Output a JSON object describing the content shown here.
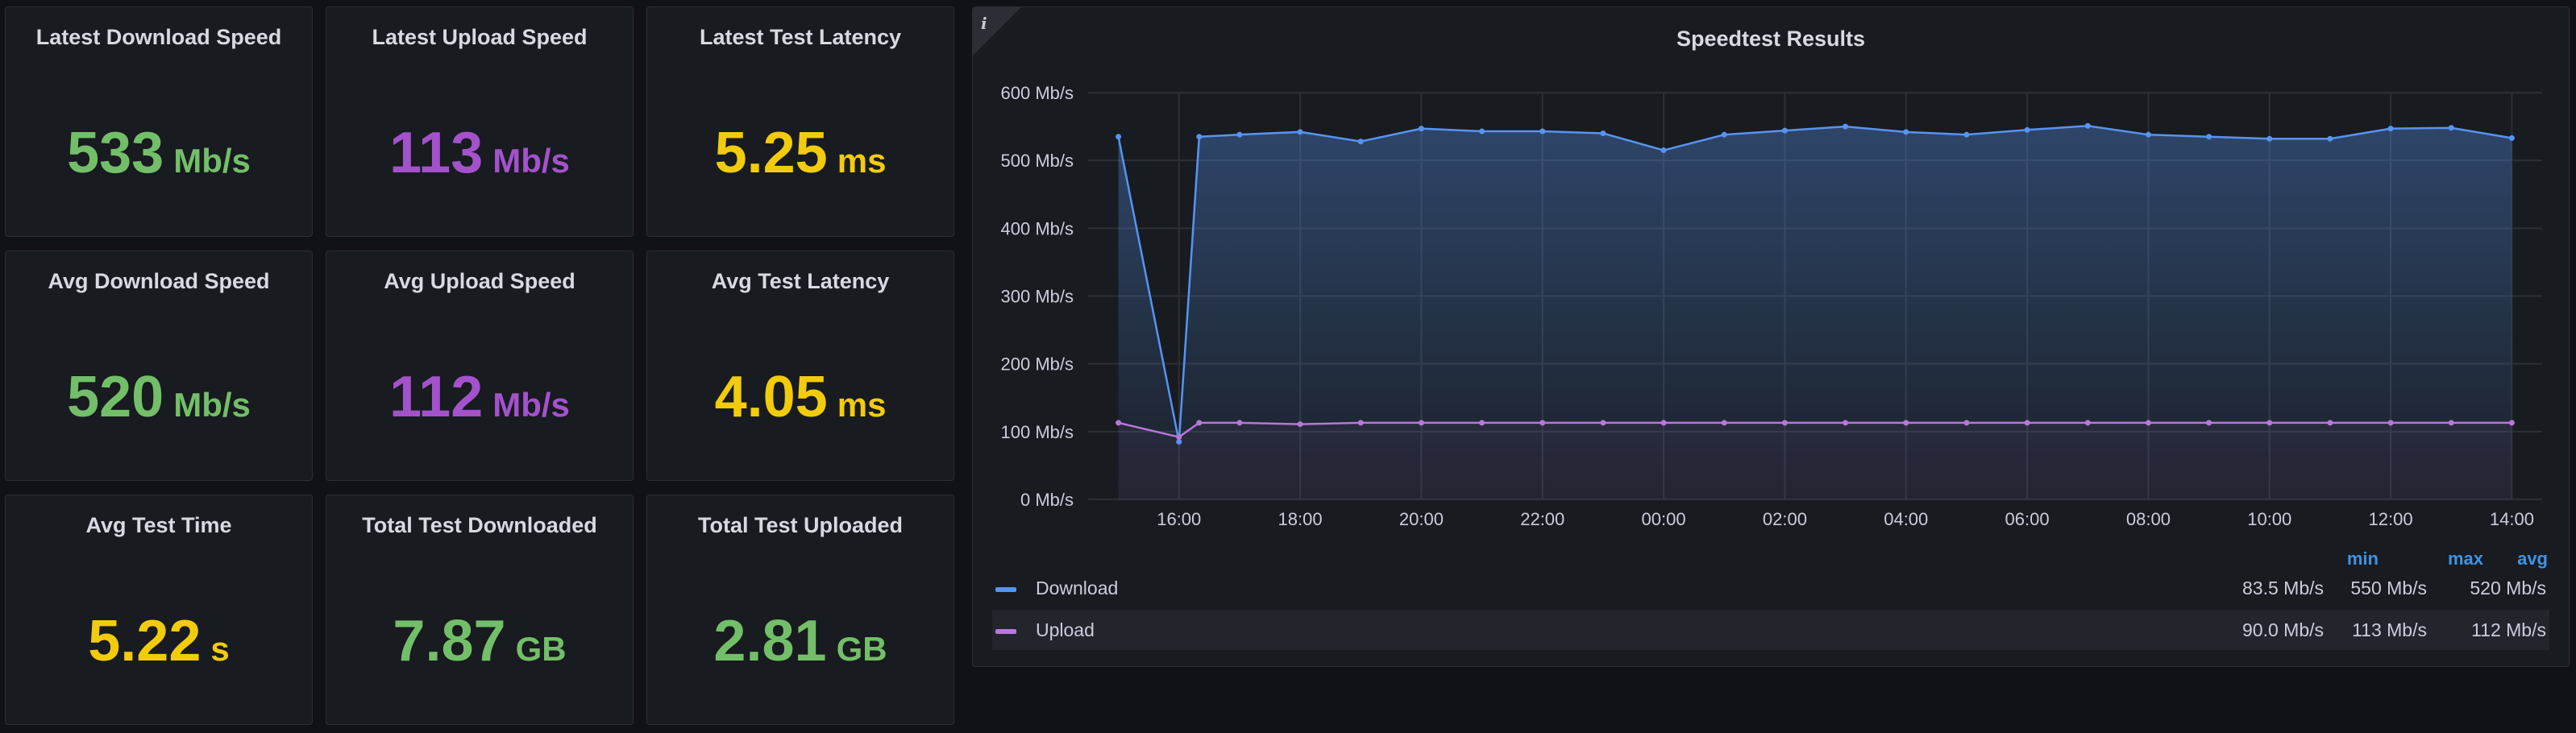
{
  "stats": [
    {
      "title": "Latest Download Speed",
      "value": "533",
      "unit": "Mb/s",
      "color": "#73bf69"
    },
    {
      "title": "Latest Upload Speed",
      "value": "113",
      "unit": "Mb/s",
      "color": "#a352cc"
    },
    {
      "title": "Latest Test Latency",
      "value": "5.25",
      "unit": "ms",
      "color": "#f2cc0c"
    },
    {
      "title": "Avg Download Speed",
      "value": "520",
      "unit": "Mb/s",
      "color": "#73bf69"
    },
    {
      "title": "Avg Upload Speed",
      "value": "112",
      "unit": "Mb/s",
      "color": "#a352cc"
    },
    {
      "title": "Avg Test Latency",
      "value": "4.05",
      "unit": "ms",
      "color": "#f2cc0c"
    },
    {
      "title": "Avg Test Time",
      "value": "5.22",
      "unit": "s",
      "color": "#f2cc0c"
    },
    {
      "title": "Total Test Downloaded",
      "value": "7.87",
      "unit": "GB",
      "color": "#73bf69"
    },
    {
      "title": "Total Test Uploaded",
      "value": "2.81",
      "unit": "GB",
      "color": "#73bf69"
    }
  ],
  "chart_panel": {
    "title": "Speedtest Results",
    "info_icon": "i"
  },
  "chart_data": {
    "type": "line",
    "title": "Speedtest Results",
    "y_ticks": [
      "0 Mb/s",
      "100 Mb/s",
      "200 Mb/s",
      "300 Mb/s",
      "400 Mb/s",
      "500 Mb/s",
      "600 Mb/s"
    ],
    "ylim": [
      0,
      600
    ],
    "x_ticks": [
      "16:00",
      "18:00",
      "20:00",
      "22:00",
      "00:00",
      "02:00",
      "04:00",
      "06:00",
      "08:00",
      "10:00",
      "12:00",
      "14:00"
    ],
    "x": [
      "15:00",
      "16:00",
      "16:20",
      "17:00",
      "18:00",
      "19:00",
      "20:00",
      "21:00",
      "22:00",
      "23:00",
      "00:00",
      "01:00",
      "02:00",
      "03:00",
      "04:00",
      "05:00",
      "06:00",
      "07:00",
      "08:00",
      "09:00",
      "10:00",
      "11:00",
      "12:00",
      "13:00",
      "14:00"
    ],
    "series": [
      {
        "name": "Download",
        "color": "#5794f2",
        "values": [
          535,
          85,
          535,
          538,
          542,
          528,
          547,
          543,
          543,
          540,
          515,
          538,
          544,
          550,
          542,
          538,
          545,
          551,
          538,
          535,
          532,
          532,
          547,
          548,
          533
        ]
      },
      {
        "name": "Upload",
        "color": "#b877d9",
        "values": [
          113,
          92,
          113,
          113,
          111,
          113,
          113,
          113,
          113,
          113,
          113,
          113,
          113,
          113,
          113,
          113,
          113,
          113,
          113,
          113,
          113,
          113,
          113,
          113,
          113
        ]
      }
    ],
    "grid": true
  },
  "legend": {
    "headers": [
      "min",
      "max",
      "avg"
    ],
    "rows": [
      {
        "name": "Download",
        "color": "#5794f2",
        "min": "83.5 Mb/s",
        "max": "550 Mb/s",
        "avg": "520 Mb/s"
      },
      {
        "name": "Upload",
        "color": "#b877d9",
        "min": "90.0 Mb/s",
        "max": "113 Mb/s",
        "avg": "112 Mb/s"
      }
    ]
  }
}
